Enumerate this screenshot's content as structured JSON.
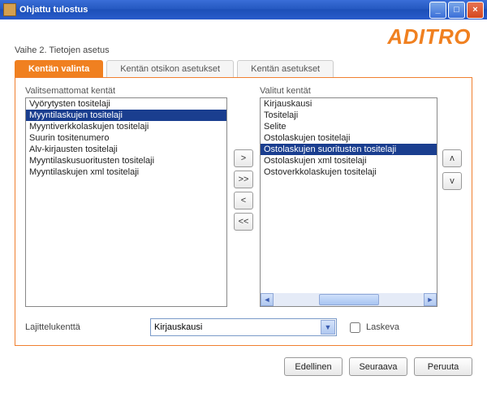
{
  "window": {
    "title": "Ohjattu tulostus"
  },
  "brand": "ADITRO",
  "step_label": "Vaihe 2. Tietojen asetus",
  "tabs": [
    {
      "label": "Kentän valinta",
      "active": true
    },
    {
      "label": "Kentän otsikon asetukset",
      "active": false
    },
    {
      "label": "Kentän asetukset",
      "active": false
    }
  ],
  "left_list": {
    "label": "Valitsemattomat kentät",
    "items": [
      "Vyörytysten tositelaji",
      "Myyntilaskujen tositelaji",
      "Myyntiverkkolaskujen tositelaji",
      "Suurin tositenumero",
      "Alv-kirjausten tositelaji",
      "Myyntilaskusuoritusten tositelaji",
      "Myyntilaskujen xml tositelaji"
    ],
    "selected_index": 1
  },
  "right_list": {
    "label": "Valitut kentät",
    "items": [
      "Kirjauskausi",
      "Tositelaji",
      "Selite",
      "Ostolaskujen tositelaji",
      "Ostolaskujen suoritusten tositelaji",
      "Ostolaskujen xml tositelaji",
      "Ostoverkkolaskujen tositelaji"
    ],
    "selected_index": 4
  },
  "move_buttons": {
    "add": ">",
    "add_all": ">>",
    "remove": "<",
    "remove_all": "<<"
  },
  "order_buttons": {
    "up": "ʌ",
    "down": "v"
  },
  "sort": {
    "label": "Lajittelukenttä",
    "value": "Kirjauskausi",
    "desc_label": "Laskeva",
    "desc_checked": false
  },
  "footer": {
    "prev": "Edellinen",
    "next": "Seuraava",
    "cancel": "Peruuta"
  }
}
